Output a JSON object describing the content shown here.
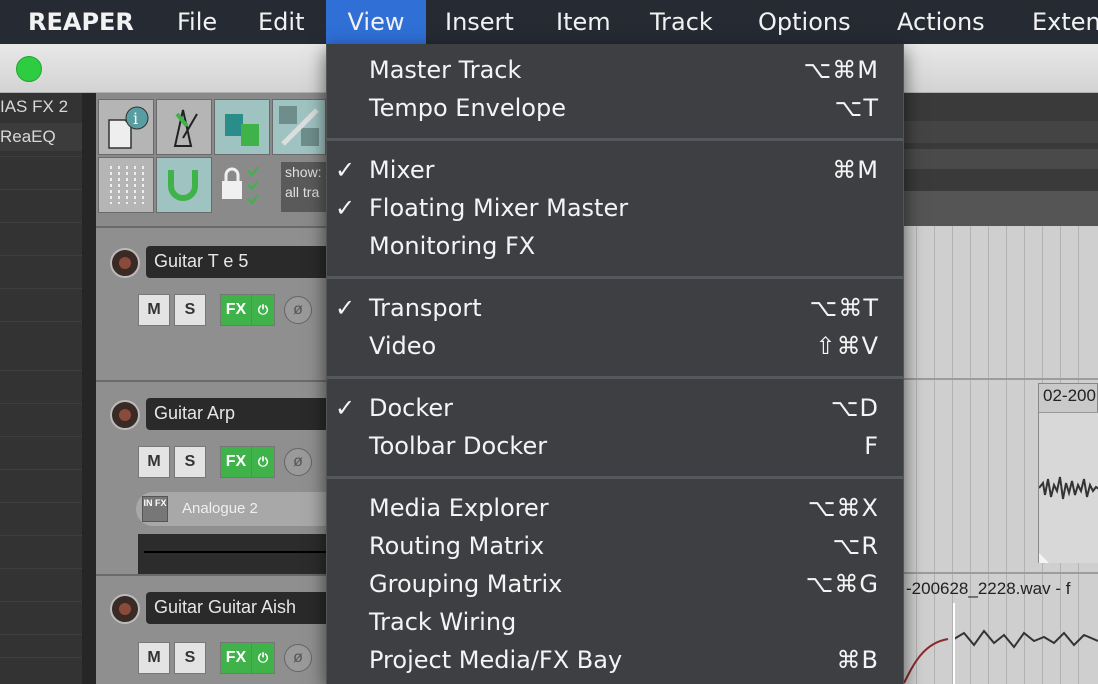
{
  "menubar": {
    "app": "REAPER",
    "items": [
      "File",
      "Edit",
      "View",
      "Insert",
      "Item",
      "Track",
      "Options",
      "Actions",
      "Exten"
    ]
  },
  "fx_list": {
    "items": [
      "IAS FX 2",
      "ReaEQ"
    ]
  },
  "toolbar": {
    "show_line1": "show:",
    "show_line2": "all tra"
  },
  "tracks": [
    {
      "name": "Guitar T e 5",
      "mute": "M",
      "solo": "S",
      "fx": "FX",
      "power": "⏻",
      "phase": "ø"
    },
    {
      "name": "Guitar Arp",
      "mute": "M",
      "solo": "S",
      "fx": "FX",
      "power": "⏻",
      "phase": "ø",
      "fx_slot": "Analogue 2",
      "fx_slot_icon": "IN FX"
    },
    {
      "name": "Guitar Guitar Aish",
      "mute": "M",
      "solo": "S",
      "fx": "FX",
      "power": "⏻",
      "phase": "ø"
    }
  ],
  "arrange": {
    "clip1_label": "02-200",
    "clip2_label": "-200628_2228.wav - f"
  },
  "view_menu": {
    "sections": [
      [
        {
          "label": "Master Track",
          "shortcut": "⌥⌘M",
          "checked": false
        },
        {
          "label": "Tempo Envelope",
          "shortcut": "⌥T",
          "checked": false
        }
      ],
      [
        {
          "label": "Mixer",
          "shortcut": "⌘M",
          "checked": true
        },
        {
          "label": "Floating Mixer Master",
          "shortcut": "",
          "checked": true
        },
        {
          "label": "Monitoring FX",
          "shortcut": "",
          "checked": false
        }
      ],
      [
        {
          "label": "Transport",
          "shortcut": "⌥⌘T",
          "checked": true
        },
        {
          "label": "Video",
          "shortcut": "⇧⌘V",
          "checked": false
        }
      ],
      [
        {
          "label": "Docker",
          "shortcut": "⌥D",
          "checked": true
        },
        {
          "label": "Toolbar Docker",
          "shortcut": "F",
          "checked": false
        }
      ],
      [
        {
          "label": "Media Explorer",
          "shortcut": "⌥⌘X",
          "checked": false
        },
        {
          "label": "Routing Matrix",
          "shortcut": "⌥R",
          "checked": false
        },
        {
          "label": "Grouping Matrix",
          "shortcut": "⌥⌘G",
          "checked": false
        },
        {
          "label": "Track Wiring",
          "shortcut": "",
          "checked": false
        },
        {
          "label": "Project Media/FX Bay",
          "shortcut": "⌘B",
          "checked": false
        }
      ]
    ],
    "check_glyph": "✓"
  },
  "colors": {
    "menubar_bg": "#262a33",
    "menu_highlight": "#2f6fd6",
    "menu_bg": "#3d3f43",
    "fx_green": "#3fb24a",
    "traffic_green": "#2ecc40"
  }
}
